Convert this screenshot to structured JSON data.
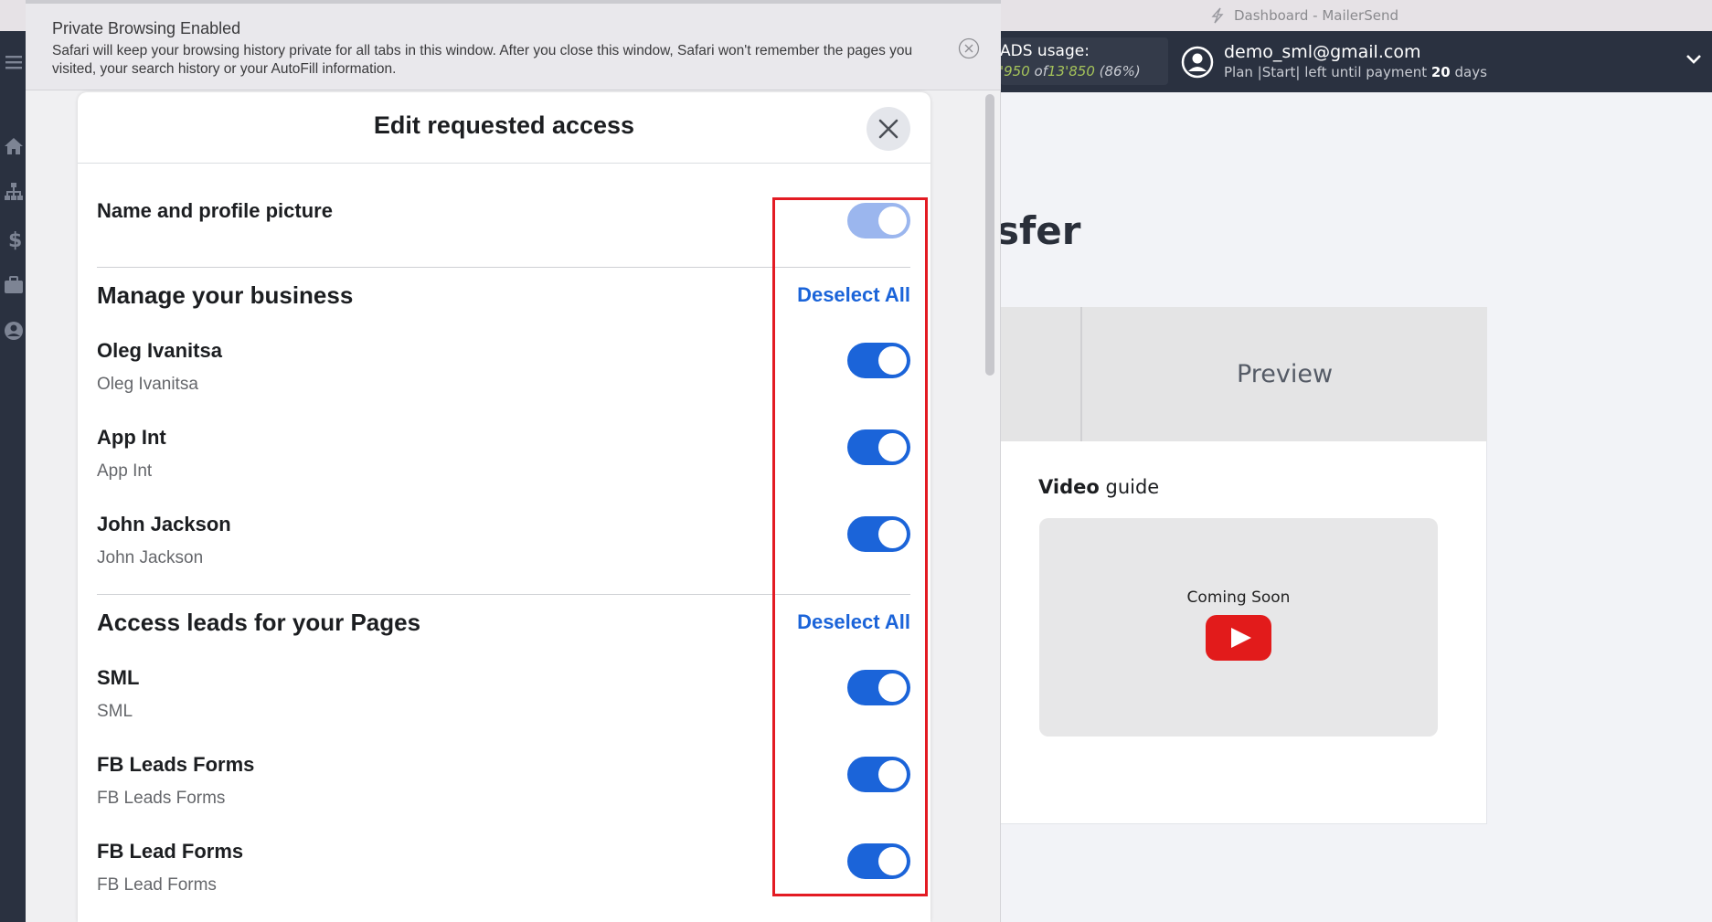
{
  "window": {
    "title": "Dashboard - MailerSend"
  },
  "header": {
    "usage_label": "ADS usage:",
    "usage_used": "'950",
    "usage_of": "of",
    "usage_total": "13'850",
    "usage_pct": "(86%)",
    "user_email": "demo_sml@gmail.com",
    "plan_prefix": "Plan |Start| left until payment",
    "plan_days": "20",
    "plan_suffix": "days"
  },
  "background_page": {
    "heading_fragment": "sfer",
    "tab_preview": "Preview",
    "video_guide_bold": "Video",
    "video_guide_rest": "guide",
    "coming_soon": "Coming Soon"
  },
  "safari_banner": {
    "title": "Private Browsing Enabled",
    "text": "Safari will keep your browsing history private for all tabs in this window. After you close this window, Safari won't remember the pages you visited, your search history or your AutoFill information."
  },
  "modal": {
    "title": "Edit requested access",
    "profile_row": {
      "label": "Name and profile picture",
      "enabled": true,
      "locked": true
    },
    "sections": [
      {
        "title": "Manage your business",
        "deselect_label": "Deselect All",
        "items": [
          {
            "title": "Oleg Ivanitsa",
            "subtitle": "Oleg Ivanitsa",
            "enabled": true
          },
          {
            "title": "App Int",
            "subtitle": "App Int",
            "enabled": true
          },
          {
            "title": "John Jackson",
            "subtitle": "John Jackson",
            "enabled": true
          }
        ]
      },
      {
        "title": "Access leads for your Pages",
        "deselect_label": "Deselect All",
        "items": [
          {
            "title": "SML",
            "subtitle": "SML",
            "enabled": true
          },
          {
            "title": "FB Leads Forms",
            "subtitle": "FB Leads Forms",
            "enabled": true
          },
          {
            "title": "FB Lead Forms",
            "subtitle": "FB Lead Forms",
            "enabled": true
          }
        ]
      }
    ]
  },
  "colors": {
    "toggle_on": "#1b64d9",
    "toggle_locked": "#9bb6ee",
    "link": "#1b64d9",
    "highlight": "#e31b23",
    "app_topbar": "#2a3140"
  }
}
